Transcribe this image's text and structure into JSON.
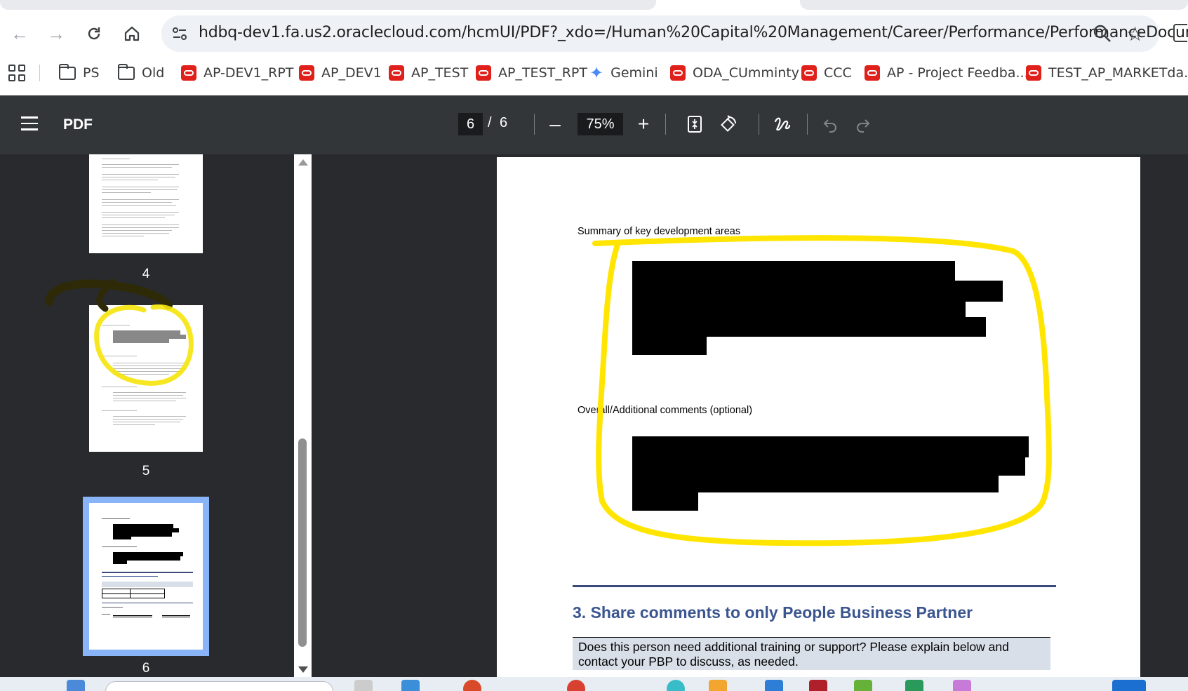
{
  "browser": {
    "url": "hdbq-dev1.fa.us2.oraclecloud.com/hcmUI/PDF?_xdo=/Human%20Capital%20Management/Career/Performance/PerformanceDocume...",
    "bookmarks": [
      {
        "label": "PS",
        "icon": "folder-icon"
      },
      {
        "label": "Old",
        "icon": "folder-icon"
      },
      {
        "label": "AP-DEV1_RPT",
        "icon": "oracle-icon"
      },
      {
        "label": "AP_DEV1",
        "icon": "oracle-icon"
      },
      {
        "label": "AP_TEST",
        "icon": "oracle-icon"
      },
      {
        "label": "AP_TEST_RPT",
        "icon": "oracle-icon"
      },
      {
        "label": "Gemini",
        "icon": "gemini-icon"
      },
      {
        "label": "ODA_CUmminty",
        "icon": "oracle-icon"
      },
      {
        "label": "CCC",
        "icon": "oracle-icon"
      },
      {
        "label": "AP - Project Feedba...",
        "icon": "oracle-icon"
      },
      {
        "label": "TEST_AP_MARKETda...",
        "icon": "oracle-icon"
      }
    ]
  },
  "pdf_toolbar": {
    "title": "PDF",
    "current_page": "6",
    "separator": "/",
    "total_pages": "6",
    "zoom": "75%"
  },
  "thumbnails": [
    {
      "number": "4"
    },
    {
      "number": "5"
    },
    {
      "number": "6",
      "selected": true
    }
  ],
  "document": {
    "summary_label": "Summary of key development areas",
    "comments_label": "Overall/Additional comments (optional)",
    "section_heading": "3. Share comments to only People Business Partner",
    "question": "Does this person need additional training or support? Please explain below and contact your PBP to discuss, as needed."
  },
  "colors": {
    "highlight": "#ffe500",
    "pdf_toolbar_bg": "#323639",
    "viewer_bg": "#282a2d",
    "heading": "#3a5590",
    "selected_thumb": "#8ab4f8"
  }
}
